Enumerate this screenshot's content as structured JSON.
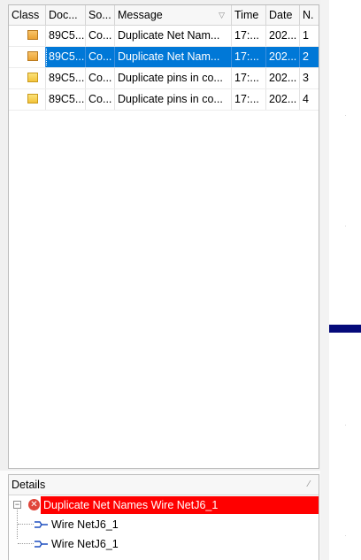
{
  "messages": {
    "columns": [
      {
        "label": "Class"
      },
      {
        "label": "Doc..."
      },
      {
        "label": "So..."
      },
      {
        "label": "Message",
        "sort_icon": "sort-indicator-icon"
      },
      {
        "label": "Time"
      },
      {
        "label": "Date"
      },
      {
        "label": "N."
      }
    ],
    "rows": [
      {
        "class_icon": "warning-icon",
        "doc": "89C5...",
        "source": "Co...",
        "message": "Duplicate Net Nam...",
        "time": "17:...",
        "date": "202...",
        "num": "1",
        "selected": false,
        "kind": "error"
      },
      {
        "class_icon": "warning-icon",
        "doc": "89C5...",
        "source": "Co...",
        "message": "Duplicate Net Nam...",
        "time": "17:...",
        "date": "202...",
        "num": "2",
        "selected": true,
        "kind": "error"
      },
      {
        "class_icon": "warning-icon",
        "doc": "89C5...",
        "source": "Co...",
        "message": "Duplicate pins in co...",
        "time": "17:...",
        "date": "202...",
        "num": "3",
        "selected": false,
        "kind": "warning"
      },
      {
        "class_icon": "warning-icon",
        "doc": "89C5...",
        "source": "Co...",
        "message": "Duplicate pins in co...",
        "time": "17:...",
        "date": "202...",
        "num": "4",
        "selected": false,
        "kind": "warning"
      }
    ]
  },
  "details": {
    "title": "Details",
    "root": {
      "label": "Duplicate Net Names Wire NetJ6_1",
      "icon": "error-icon",
      "expander": "⊟"
    },
    "children": [
      {
        "label": "Wire NetJ6_1",
        "icon": "wire-icon"
      },
      {
        "label": "Wire NetJ6_1",
        "icon": "wire-icon"
      }
    ]
  },
  "colors": {
    "selection": "#0078d7",
    "error_highlight": "#ff0000",
    "wire": "#050a7a"
  }
}
